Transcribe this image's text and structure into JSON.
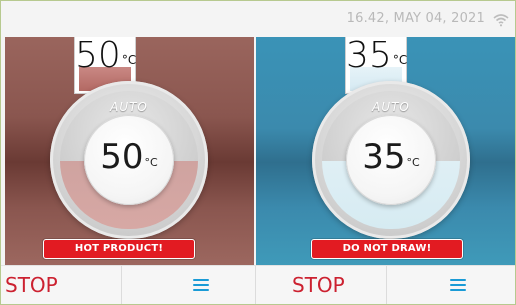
{
  "status_bar": {
    "datetime": "16.42, MAY 04, 2021",
    "wifi_icon": "wifi-icon"
  },
  "left_panel": {
    "color": "#8a564f",
    "gauge": {
      "value": "50",
      "unit": "°C",
      "level": 0.4
    },
    "dial": {
      "mode": "AUTO",
      "value": "50",
      "unit": "°C"
    },
    "alert": "HOT PRODUCT!"
  },
  "right_panel": {
    "color": "#3b8aad",
    "gauge": {
      "value": "35",
      "unit": "°C",
      "level": 0.4
    },
    "dial": {
      "mode": "AUTO",
      "value": "35",
      "unit": "°C"
    },
    "alert": "DO NOT DRAW!"
  },
  "bottom_bar": {
    "left_stop": "STOP",
    "right_stop": "STOP",
    "menu_icon": "menu-icon",
    "accent_stop": "#cc2130",
    "accent_menu": "#1a9bd6"
  }
}
